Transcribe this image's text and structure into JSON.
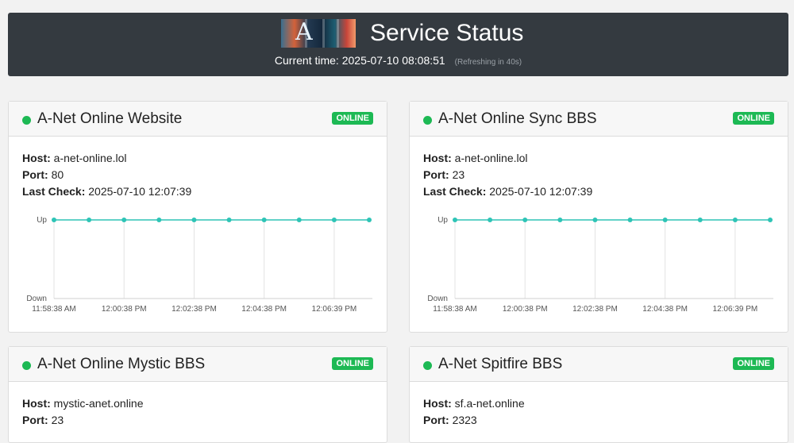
{
  "header": {
    "title": "Service Status",
    "time_label": "Current time:",
    "current_time": "2025-07-10 08:08:51",
    "refresh_text": "(Refreshing in 40s)"
  },
  "labels": {
    "host": "Host:",
    "port": "Port:",
    "last_check": "Last Check:"
  },
  "colors": {
    "online": "#1db954",
    "line": "#2ec4b6"
  },
  "services": [
    {
      "name": "A-Net Online Website",
      "status": "ONLINE",
      "host": "a-net-online.lol",
      "port": "80",
      "last_check": "2025-07-10 12:07:39",
      "chart_data": {
        "type": "line",
        "y_categories": [
          "Down",
          "Up"
        ],
        "x_ticks": [
          "11:58:38 AM",
          "12:00:38 PM",
          "12:02:38 PM",
          "12:04:38 PM",
          "12:06:39 PM"
        ],
        "values": [
          1,
          1,
          1,
          1,
          1,
          1,
          1,
          1,
          1,
          1
        ]
      }
    },
    {
      "name": "A-Net Online Sync BBS",
      "status": "ONLINE",
      "host": "a-net-online.lol",
      "port": "23",
      "last_check": "2025-07-10 12:07:39",
      "chart_data": {
        "type": "line",
        "y_categories": [
          "Down",
          "Up"
        ],
        "x_ticks": [
          "11:58:38 AM",
          "12:00:38 PM",
          "12:02:38 PM",
          "12:04:38 PM",
          "12:06:39 PM"
        ],
        "values": [
          1,
          1,
          1,
          1,
          1,
          1,
          1,
          1,
          1,
          1
        ]
      }
    },
    {
      "name": "A-Net Online Mystic BBS",
      "status": "ONLINE",
      "host": "mystic-anet.online",
      "port": "23"
    },
    {
      "name": "A-Net Spitfire BBS",
      "status": "ONLINE",
      "host": "sf.a-net.online",
      "port": "2323"
    }
  ]
}
